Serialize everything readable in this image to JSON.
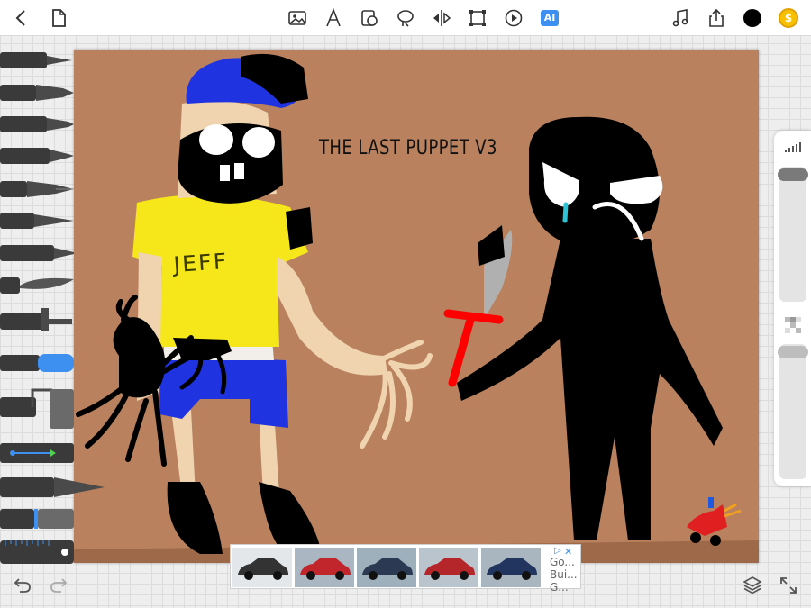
{
  "canvas": {
    "title": "THE LAST PUPPET V3",
    "shirt_text": "JEFF"
  },
  "colors": {
    "canvas_background": "#b9815e",
    "ai_badge": "#3d8ff0",
    "current_color": "#000000",
    "coin": "#f7c100"
  },
  "toolbar": {
    "ai_label": "AI",
    "coin_symbol": "$",
    "icons": [
      "back-icon",
      "document-icon",
      "image-icon",
      "text-icon",
      "shape-icon",
      "lasso-icon",
      "symmetry-icon",
      "transform-icon",
      "play-icon",
      "music-icon",
      "share-icon"
    ]
  },
  "ad": {
    "text_lines": [
      "Go...",
      "Bui...",
      "G..."
    ],
    "info_symbol": "▷",
    "close_symbol": "✕"
  }
}
